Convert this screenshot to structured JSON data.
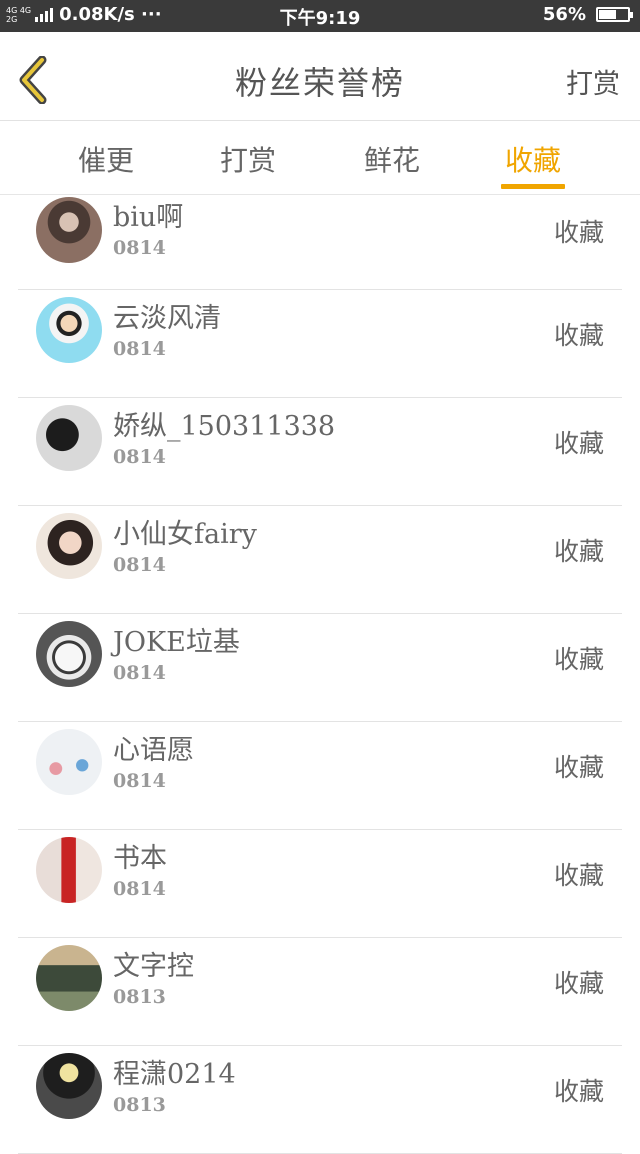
{
  "status_bar": {
    "network_top": "4G 4G",
    "network_bottom": "2G",
    "speed": "0.08K/s ···",
    "time": "下午9:19",
    "battery_percent": "56%",
    "battery_level": 0.56
  },
  "header": {
    "title": "粉丝荣誉榜",
    "reward_label": "打赏"
  },
  "tabs": [
    {
      "label": "催更",
      "active": false
    },
    {
      "label": "打赏",
      "active": false
    },
    {
      "label": "鲜花",
      "active": false
    },
    {
      "label": "收藏",
      "active": true
    }
  ],
  "accent_color": "#f0a500",
  "rows": [
    {
      "name": "biu啊",
      "date": "0814",
      "action": "收藏"
    },
    {
      "name": "云淡风清",
      "date": "0814",
      "action": "收藏"
    },
    {
      "name": "娇纵_150311338",
      "date": "0814",
      "action": "收藏"
    },
    {
      "name": "小仙女fairy",
      "date": "0814",
      "action": "收藏"
    },
    {
      "name": "JOKE垃基",
      "date": "0814",
      "action": "收藏"
    },
    {
      "name": "心语愿",
      "date": "0814",
      "action": "收藏"
    },
    {
      "name": "书本",
      "date": "0814",
      "action": "收藏"
    },
    {
      "name": "文字控",
      "date": "0813",
      "action": "收藏"
    },
    {
      "name": "程潇0214",
      "date": "0813",
      "action": "收藏"
    }
  ]
}
